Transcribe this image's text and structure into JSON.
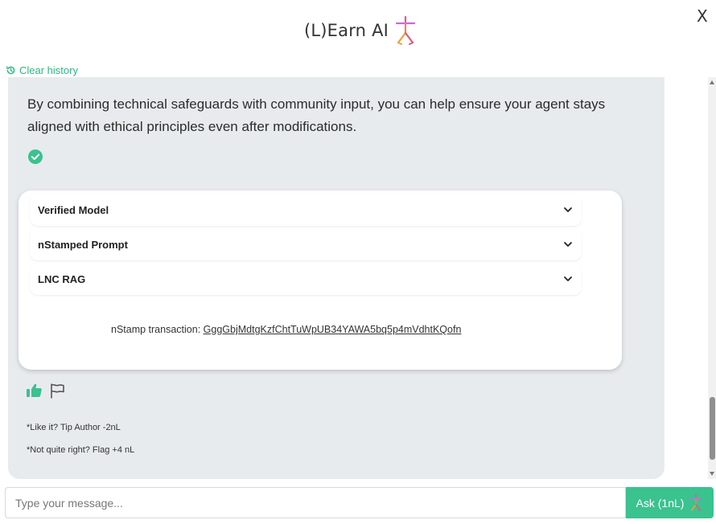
{
  "header": {
    "title": "(L)Earn AI",
    "close_label": "X"
  },
  "toolbar": {
    "clear_history_label": "Clear history"
  },
  "message": {
    "text": "By combining technical safeguards with community input, you can help ensure your agent stays aligned with ethical principles even after modifications.",
    "verified": true,
    "accordion": [
      {
        "label": "Verified Model"
      },
      {
        "label": "nStamped Prompt"
      },
      {
        "label": "LNC RAG"
      }
    ],
    "transaction_label": "nStamp transaction: ",
    "transaction_id": "GggGbjMdtgKzfChtTuWpUB34YAWA5bq5p4mVdhtKQofn",
    "tip_note": "*Like it? Tip Author -2nL",
    "flag_note": "*Not quite right? Flag +4 nL"
  },
  "composer": {
    "placeholder": "Type your message...",
    "ask_label": "Ask (1nL)"
  },
  "colors": {
    "accent": "#3ac28f",
    "bubble": "#e8ebee"
  }
}
